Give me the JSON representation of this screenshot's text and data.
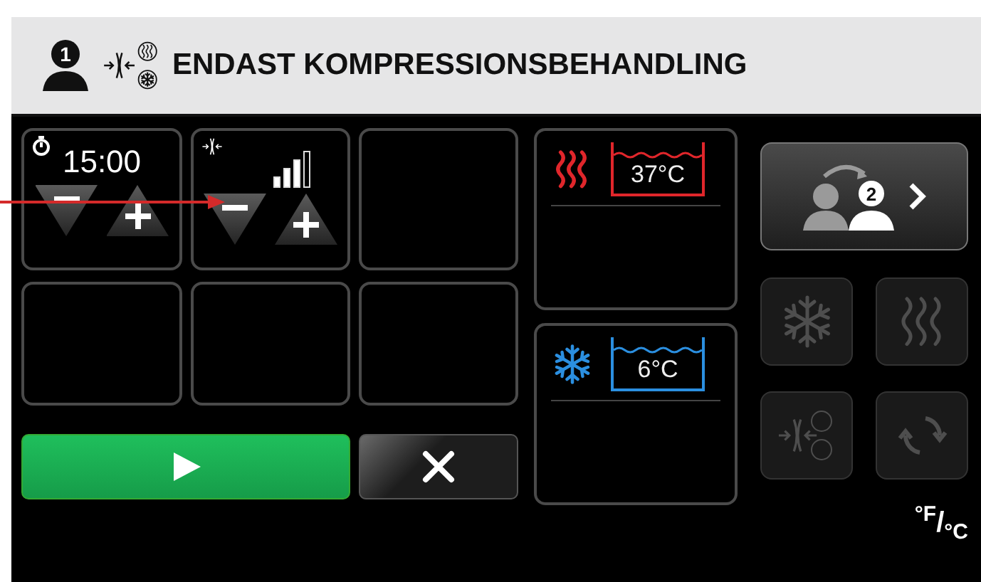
{
  "header": {
    "patient": "1",
    "title": "ENDAST KOMPRESSIONSBEHANDLING"
  },
  "settings": [
    {
      "kind": "timer",
      "value": "15:00"
    },
    {
      "kind": "compression",
      "level": 0.75
    },
    {
      "kind": "empty"
    },
    {
      "kind": "empty"
    },
    {
      "kind": "empty"
    },
    {
      "kind": "empty"
    }
  ],
  "baths": [
    {
      "kind": "heat",
      "temperature": "37°C",
      "color": "#e0262b"
    },
    {
      "kind": "cold",
      "temperature": "6°C",
      "color": "#2b8fe0"
    }
  ],
  "next_patient": {
    "number": "2"
  },
  "modes": [
    {
      "kind": "cold",
      "disabled": true
    },
    {
      "kind": "heat",
      "disabled": true
    },
    {
      "kind": "compression",
      "disabled": true
    },
    {
      "kind": "contrast",
      "disabled": true
    }
  ],
  "unit_toggle": "$^{°F}$/$_{°C}$"
}
